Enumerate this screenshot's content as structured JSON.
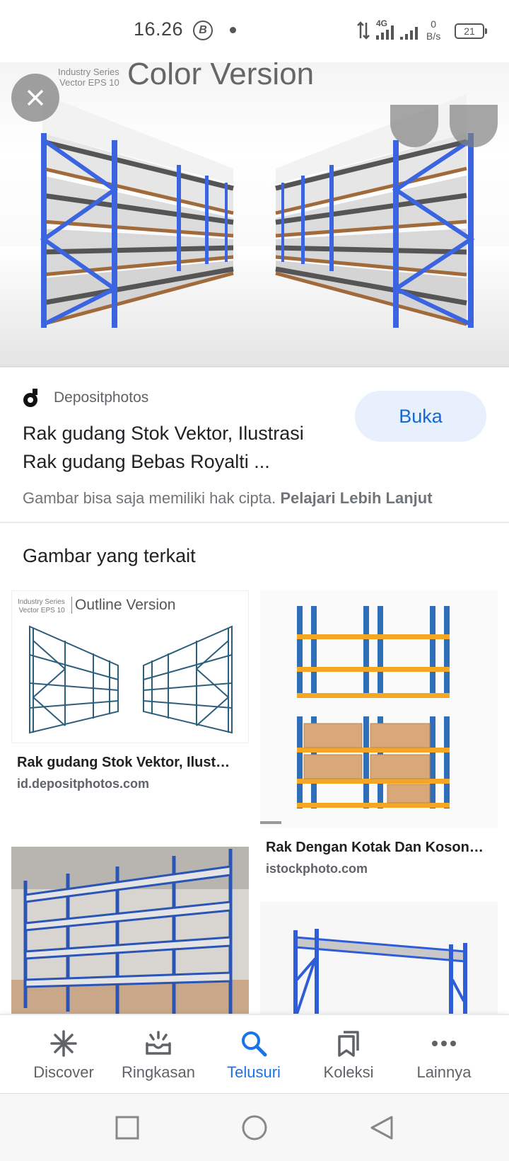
{
  "status_bar": {
    "time": "16.26",
    "b_icon_letter": "B",
    "network_type": "4G",
    "speed_value": "0",
    "speed_unit": "B/s",
    "battery_level": "21"
  },
  "hero": {
    "series_line1": "Industry Series",
    "series_line2": "Vector EPS 10",
    "caption": "Color Version"
  },
  "result": {
    "source_name": "Depositphotos",
    "title": "Rak gudang Stok Vektor, Ilustrasi Rak gudang Bebas Royalti ...",
    "open_button": "Buka",
    "copyright_text": "Gambar bisa saja memiliki hak cipta.",
    "learn_more": "Pelajari Lebih Lanjut"
  },
  "related": {
    "heading": "Gambar yang terkait",
    "items": [
      {
        "title": "Rak gudang Stok Vektor, Ilust…",
        "site": "id.depositphotos.com",
        "thumb_series1": "Industry Series",
        "thumb_series2": "Vector EPS 10",
        "thumb_caption": "Outline Version"
      },
      {
        "title": "Rak Dengan Kotak Dan Koson…",
        "site": "istockphoto.com"
      },
      {
        "title": "",
        "site": ""
      },
      {
        "title": "",
        "site": ""
      }
    ]
  },
  "bottom_nav": {
    "items": [
      {
        "label": "Discover",
        "icon": "asterisk-icon"
      },
      {
        "label": "Ringkasan",
        "icon": "summary-icon"
      },
      {
        "label": "Telusuri",
        "icon": "search-icon"
      },
      {
        "label": "Koleksi",
        "icon": "collections-icon"
      },
      {
        "label": "Lainnya",
        "icon": "more-icon"
      }
    ],
    "active_index": 2,
    "active_color": "#1a73e8"
  },
  "colors": {
    "rack_blue": "#3a64e0",
    "rack_orange": "#f5a623",
    "accent_blue": "#1a73e8",
    "button_bg": "#e8f0fe"
  }
}
